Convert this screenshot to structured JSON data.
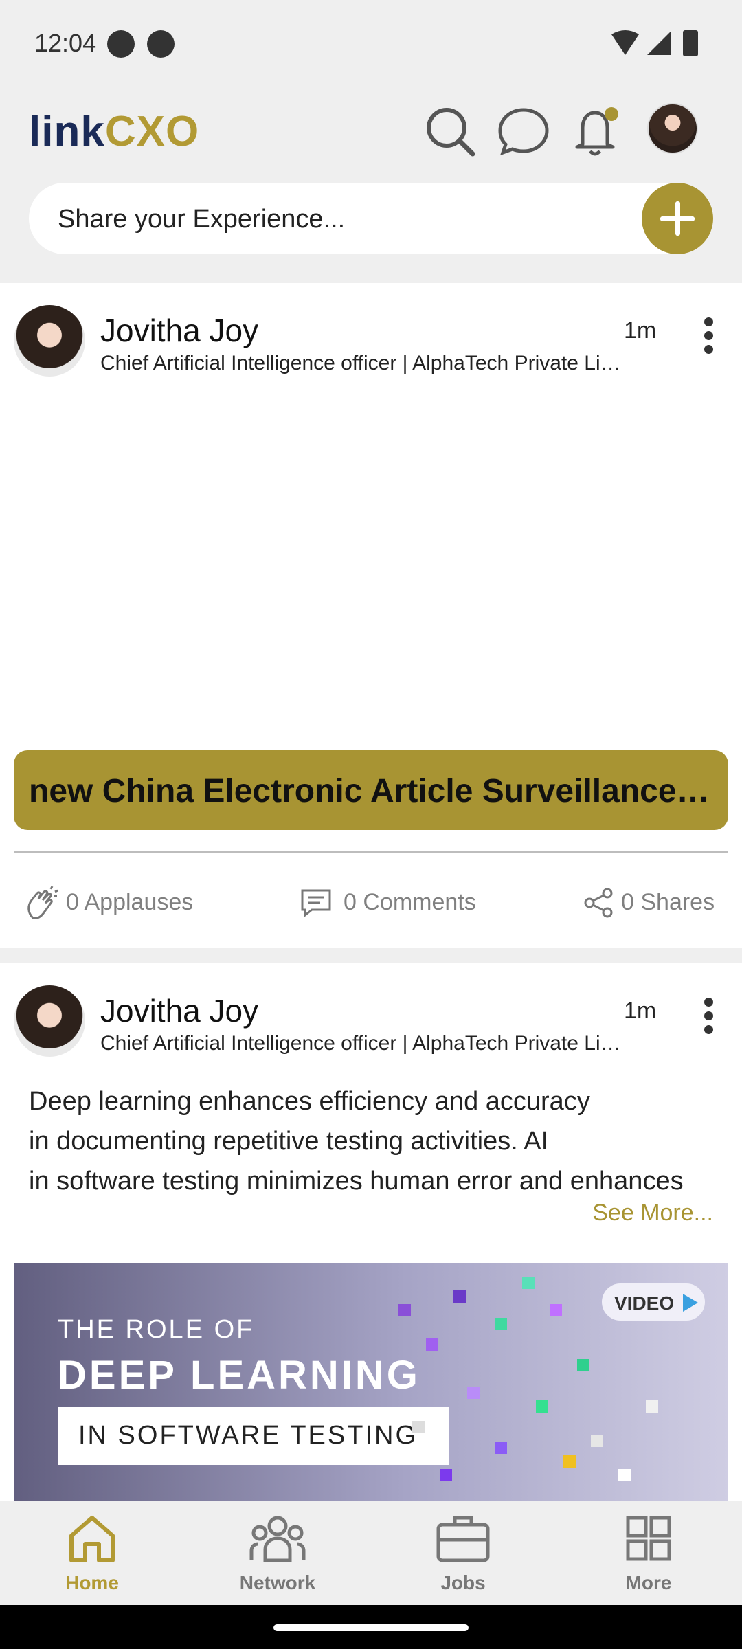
{
  "status": {
    "time": "12:04"
  },
  "header": {
    "logo_part1": "link",
    "logo_part2": "CXO",
    "share_placeholder": "Share your Experience..."
  },
  "posts": [
    {
      "author": "Jovitha Joy",
      "headline": "Chief Artificial Intelligence officer | AlphaTech Private Limited",
      "time": "1m",
      "banner_text": "new China Electronic Article Surveillance Systems Market",
      "applauses": "0 Applauses",
      "comments": "0 Comments",
      "shares": "0 Shares"
    },
    {
      "author": "Jovitha Joy",
      "headline": "Chief Artificial Intelligence officer | AlphaTech Private Limited",
      "time": "1m",
      "body_lines": [
        "Deep learning enhances efficiency and accuracy",
        "in documenting repetitive testing activities. AI",
        "in software testing minimizes human error and enhances"
      ],
      "see_more": "See More...",
      "media": {
        "line1": "THE ROLE OF",
        "line2": "DEEP LEARNING",
        "line3": "IN SOFTWARE TESTING",
        "badge": "VIDEO"
      }
    }
  ],
  "nav": {
    "home": "Home",
    "network": "Network",
    "jobs": "Jobs",
    "more": "More"
  },
  "colors": {
    "accent": "#a89433",
    "brand_dark": "#1a2a57"
  },
  "icons": [
    "search-icon",
    "chat-icon",
    "bell-icon",
    "plus-icon",
    "more-vert-icon",
    "clap-icon",
    "comment-icon",
    "share-icon",
    "home-icon",
    "network-icon",
    "jobs-icon",
    "grid-icon"
  ]
}
